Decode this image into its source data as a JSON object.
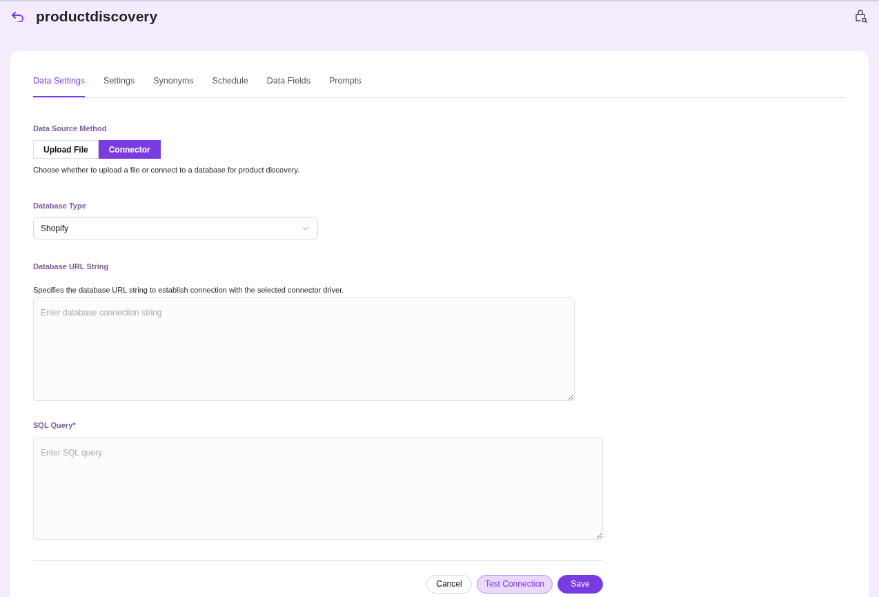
{
  "header": {
    "title": "productdiscovery"
  },
  "tabs": [
    {
      "label": "Data Settings",
      "selected": true
    },
    {
      "label": "Settings",
      "selected": false
    },
    {
      "label": "Synonyms",
      "selected": false
    },
    {
      "label": "Schedule",
      "selected": false
    },
    {
      "label": "Data Fields",
      "selected": false
    },
    {
      "label": "Prompts",
      "selected": false
    }
  ],
  "data_source_method": {
    "label": "Data Source Method",
    "options": [
      {
        "label": "Upload File",
        "selected": false
      },
      {
        "label": "Connector",
        "selected": true
      }
    ],
    "help": "Choose whether to upload a file or connect to a database for product discovery."
  },
  "database_type": {
    "label": "Database Type",
    "value": "Shopify"
  },
  "database_url": {
    "label": "Database URL String",
    "help": "Specifies the database URL string to establish connection with the selected connector driver.",
    "placeholder": "Enter database connection string"
  },
  "sql_query": {
    "label": "SQL Query*",
    "placeholder": "Enter SQL query"
  },
  "buttons": [
    {
      "label": "Cancel",
      "kind": "outline"
    },
    {
      "label": "Test Connection",
      "kind": "soft"
    },
    {
      "label": "Save",
      "kind": "primary"
    }
  ]
}
